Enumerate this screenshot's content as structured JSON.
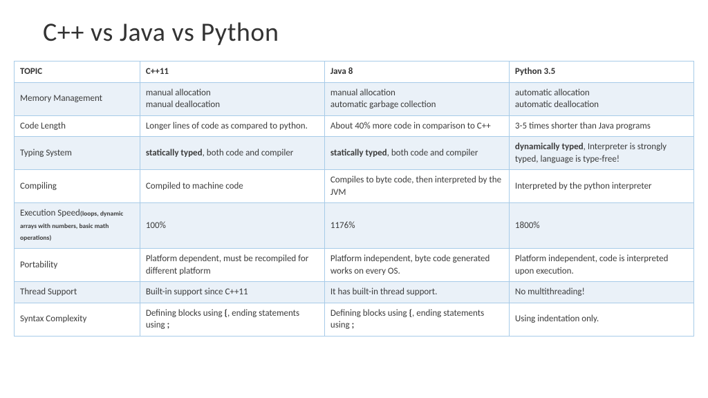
{
  "title": "C++ vs Java vs Python",
  "headers": {
    "topic": "TOPIC",
    "cpp": "C++11",
    "java": "Java 8",
    "python": "Python 3.5"
  },
  "rows": {
    "memory": {
      "topic": "Memory Management",
      "cpp_l1": "manual allocation",
      "cpp_l2": "manual deallocation",
      "java_l1": "manual allocation",
      "java_l2": "automatic garbage collection",
      "py_l1": "automatic allocation",
      "py_l2": "automatic deallocation"
    },
    "codelen": {
      "topic": "Code Length",
      "cpp": "Longer lines of code as compared to python.",
      "java": "About 40% more code in comparison to C++",
      "py": "3-5 times shorter than Java programs"
    },
    "typing": {
      "topic": "Typing System",
      "cpp_b": "statically typed",
      "cpp_r": ", both code and compiler",
      "java_b": "statically typed",
      "java_r": ", both code and compiler",
      "py_b": "dynamically typed",
      "py_r": ", Interpreter is strongly typed, language is type-free!"
    },
    "compiling": {
      "topic": "Compiling",
      "cpp": "Compiled to machine code",
      "java": "Compiles to byte code, then interpreted by the JVM",
      "py": "Interpreted by the python interpreter"
    },
    "exec": {
      "topic_main": "Execution Speed",
      "topic_sub": "(loops, dynamic arrays with numbers, basic math operations)",
      "cpp": "100%",
      "java": "1176%",
      "py": "1800%"
    },
    "portability": {
      "topic": "Portability",
      "cpp": "Platform dependent, must be recompiled for different platform",
      "java": "Platform independent, byte code generated works on every OS.",
      "py": "Platform independent, code is interpreted upon execution."
    },
    "thread": {
      "topic": "Thread Support",
      "cpp": "Built-in support since C++11",
      "java": "It has built-in thread support.",
      "py": "No multithreading!"
    },
    "syntax": {
      "topic": "Syntax Complexity",
      "cpp_a": "Defining blocks using ",
      "cpp_b1": "{",
      "cpp_b": ", ending statements using ",
      "cpp_b2": ";",
      "java_a": "Defining blocks using ",
      "java_b1": "{",
      "java_b": ", ending statements using ",
      "java_b2": ";",
      "py": "Using indentation only."
    }
  },
  "chart_data": {
    "type": "table",
    "title": "C++ vs Java vs Python",
    "columns": [
      "TOPIC",
      "C++11",
      "Java 8",
      "Python 3.5"
    ],
    "rows": [
      [
        "Memory Management",
        "manual allocation / manual deallocation",
        "manual allocation / automatic garbage collection",
        "automatic allocation / automatic deallocation"
      ],
      [
        "Code Length",
        "Longer lines of code as compared to python.",
        "About 40% more code in comparison to C++",
        "3-5 times shorter than Java programs"
      ],
      [
        "Typing System",
        "statically typed, both code and compiler",
        "statically typed, both code and compiler",
        "dynamically typed, Interpreter is strongly typed, language is type-free!"
      ],
      [
        "Compiling",
        "Compiled to machine code",
        "Compiles to byte code, then interpreted by the JVM",
        "Interpreted by the python interpreter"
      ],
      [
        "Execution Speed (loops, dynamic arrays with numbers, basic math operations)",
        "100%",
        "1176%",
        "1800%"
      ],
      [
        "Portability",
        "Platform dependent, must be recompiled for different platform",
        "Platform independent, byte code generated works on every OS.",
        "Platform independent, code is interpreted upon execution."
      ],
      [
        "Thread Support",
        "Built-in support since C++11",
        "It has built-in thread support.",
        "No multithreading!"
      ],
      [
        "Syntax Complexity",
        "Defining blocks using {, ending statements using ;",
        "Defining blocks using {, ending statements using ;",
        "Using indentation only."
      ]
    ]
  }
}
